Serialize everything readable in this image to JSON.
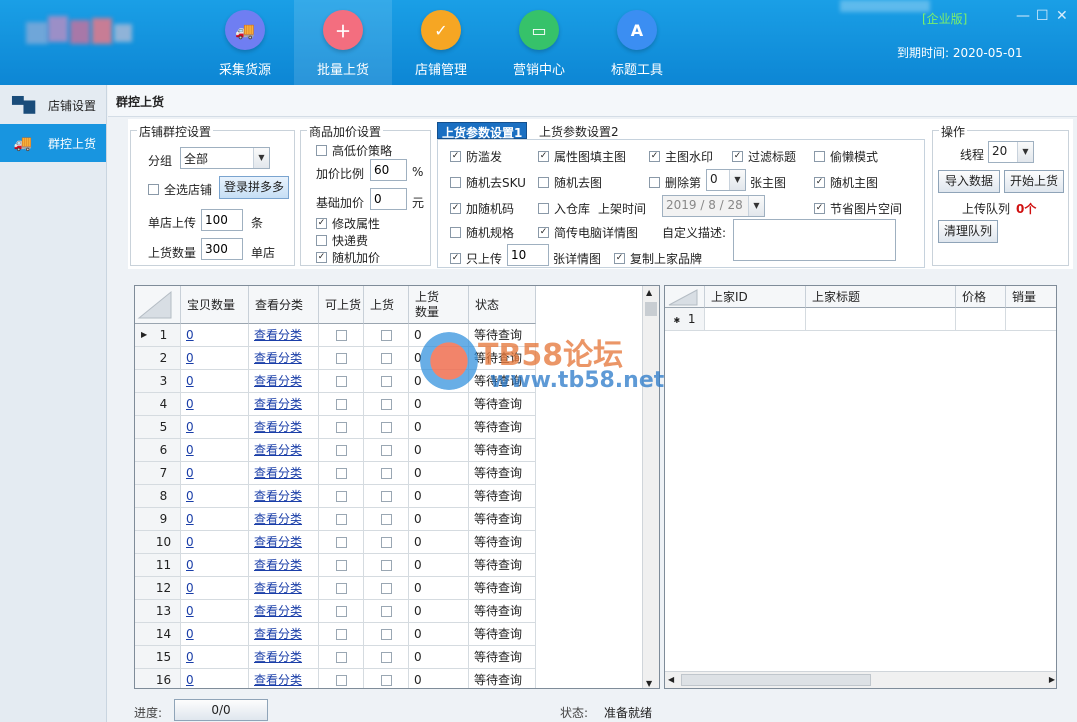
{
  "app": {
    "edition": "[企业版]",
    "expire_label": "到期时间: 2020-05-01"
  },
  "nav": [
    {
      "label": "采集货源",
      "color": "#6f7ef2",
      "glyph": "🚚"
    },
    {
      "label": "批量上货",
      "color": "#f36e7f",
      "glyph": "＋"
    },
    {
      "label": "店铺管理",
      "color": "#f6a623",
      "glyph": "✓"
    },
    {
      "label": "营销中心",
      "color": "#36c26a",
      "glyph": "▭"
    },
    {
      "label": "标题工具",
      "color": "#3b8ef2",
      "glyph": "A"
    }
  ],
  "sidebar": [
    {
      "label": "店铺设置",
      "icon": "store-icon"
    },
    {
      "label": "群控上货",
      "icon": "truck-icon"
    }
  ],
  "page_title": "群控上货",
  "store_group": {
    "title": "店铺群控设置",
    "group_label": "分组",
    "group_value": "全部",
    "select_all": "全选店铺",
    "login_btn": "登录拼多多",
    "per_store_label": "单店上传",
    "per_store_value": "100",
    "per_store_unit": "条",
    "qty_label": "上货数量",
    "qty_value": "300",
    "qty_unit": "单店"
  },
  "price_group": {
    "title": "商品加价设置",
    "strategy": "高低价策略",
    "ratio_label": "加价比例",
    "ratio_value": "60",
    "ratio_unit": "%",
    "base_label": "基础加价",
    "base_value": "0",
    "base_unit": "元",
    "modify_attr": "修改属性",
    "shipping": "快递费",
    "random_price": "随机加价"
  },
  "tabs": {
    "tab1": "上货参数设置1",
    "tab2": "上货参数设置2",
    "options": {
      "anti_spam": "防滥发",
      "attr_fill": "属性图填主图",
      "watermark": "主图水印",
      "filter_title": "过滤标题",
      "lazy": "偷懒模式",
      "rand_sku": "随机去SKU",
      "rand_img": "随机去图",
      "delete_prefix": "删除第",
      "delete_value": "0",
      "delete_suffix": "张主图",
      "rand_main": "随机主图",
      "add_code": "加随机码",
      "warehouse": "入仓库",
      "shelf_time_label": "上架时间",
      "shelf_time_value": "2019 / 8 / 28",
      "save_space": "节省图片空间",
      "rand_spec": "随机规格",
      "simple_desc": "简传电脑详情图",
      "custom_desc": "自定义描述:",
      "only_upload": "只上传",
      "only_value": "10",
      "detail_suffix": "张详情图",
      "copy_brand": "复制上家品牌"
    }
  },
  "ops": {
    "title": "操作",
    "thread_label": "线程",
    "thread_value": "20",
    "import_btn": "导入数据",
    "start_btn": "开始上货",
    "queue_label": "上传队列",
    "queue_value": "0个",
    "clear_btn": "清理队列"
  },
  "left_grid": {
    "headers": [
      "宝贝数量",
      "查看分类",
      "可上货",
      "上货",
      "上货\n数量",
      "状态"
    ],
    "rows": [
      {
        "n": "1",
        "qty": "0",
        "link": "查看分类",
        "up": "0",
        "status": "等待查询"
      },
      {
        "n": "2",
        "qty": "0",
        "link": "查看分类",
        "up": "0",
        "status": "等待查询"
      },
      {
        "n": "3",
        "qty": "0",
        "link": "查看分类",
        "up": "0",
        "status": "等待查询"
      },
      {
        "n": "4",
        "qty": "0",
        "link": "查看分类",
        "up": "0",
        "status": "等待查询"
      },
      {
        "n": "5",
        "qty": "0",
        "link": "查看分类",
        "up": "0",
        "status": "等待查询"
      },
      {
        "n": "6",
        "qty": "0",
        "link": "查看分类",
        "up": "0",
        "status": "等待查询"
      },
      {
        "n": "7",
        "qty": "0",
        "link": "查看分类",
        "up": "0",
        "status": "等待查询"
      },
      {
        "n": "8",
        "qty": "0",
        "link": "查看分类",
        "up": "0",
        "status": "等待查询"
      },
      {
        "n": "9",
        "qty": "0",
        "link": "查看分类",
        "up": "0",
        "status": "等待查询"
      },
      {
        "n": "10",
        "qty": "0",
        "link": "查看分类",
        "up": "0",
        "status": "等待查询"
      },
      {
        "n": "11",
        "qty": "0",
        "link": "查看分类",
        "up": "0",
        "status": "等待查询"
      },
      {
        "n": "12",
        "qty": "0",
        "link": "查看分类",
        "up": "0",
        "status": "等待查询"
      },
      {
        "n": "13",
        "qty": "0",
        "link": "查看分类",
        "up": "0",
        "status": "等待查询"
      },
      {
        "n": "14",
        "qty": "0",
        "link": "查看分类",
        "up": "0",
        "status": "等待查询"
      },
      {
        "n": "15",
        "qty": "0",
        "link": "查看分类",
        "up": "0",
        "status": "等待查询"
      },
      {
        "n": "16",
        "qty": "0",
        "link": "查看分类",
        "up": "0",
        "status": "等待查询"
      }
    ]
  },
  "right_grid": {
    "headers": [
      "上家ID",
      "上家标题",
      "价格",
      "销量"
    ],
    "row_marker": "1"
  },
  "watermark": {
    "line1": "TB58论坛",
    "line2": "www.tb58.net"
  },
  "footer": {
    "progress_label": "进度:",
    "progress_value": "0/0",
    "status_label": "状态:",
    "status_value": "准备就绪"
  }
}
